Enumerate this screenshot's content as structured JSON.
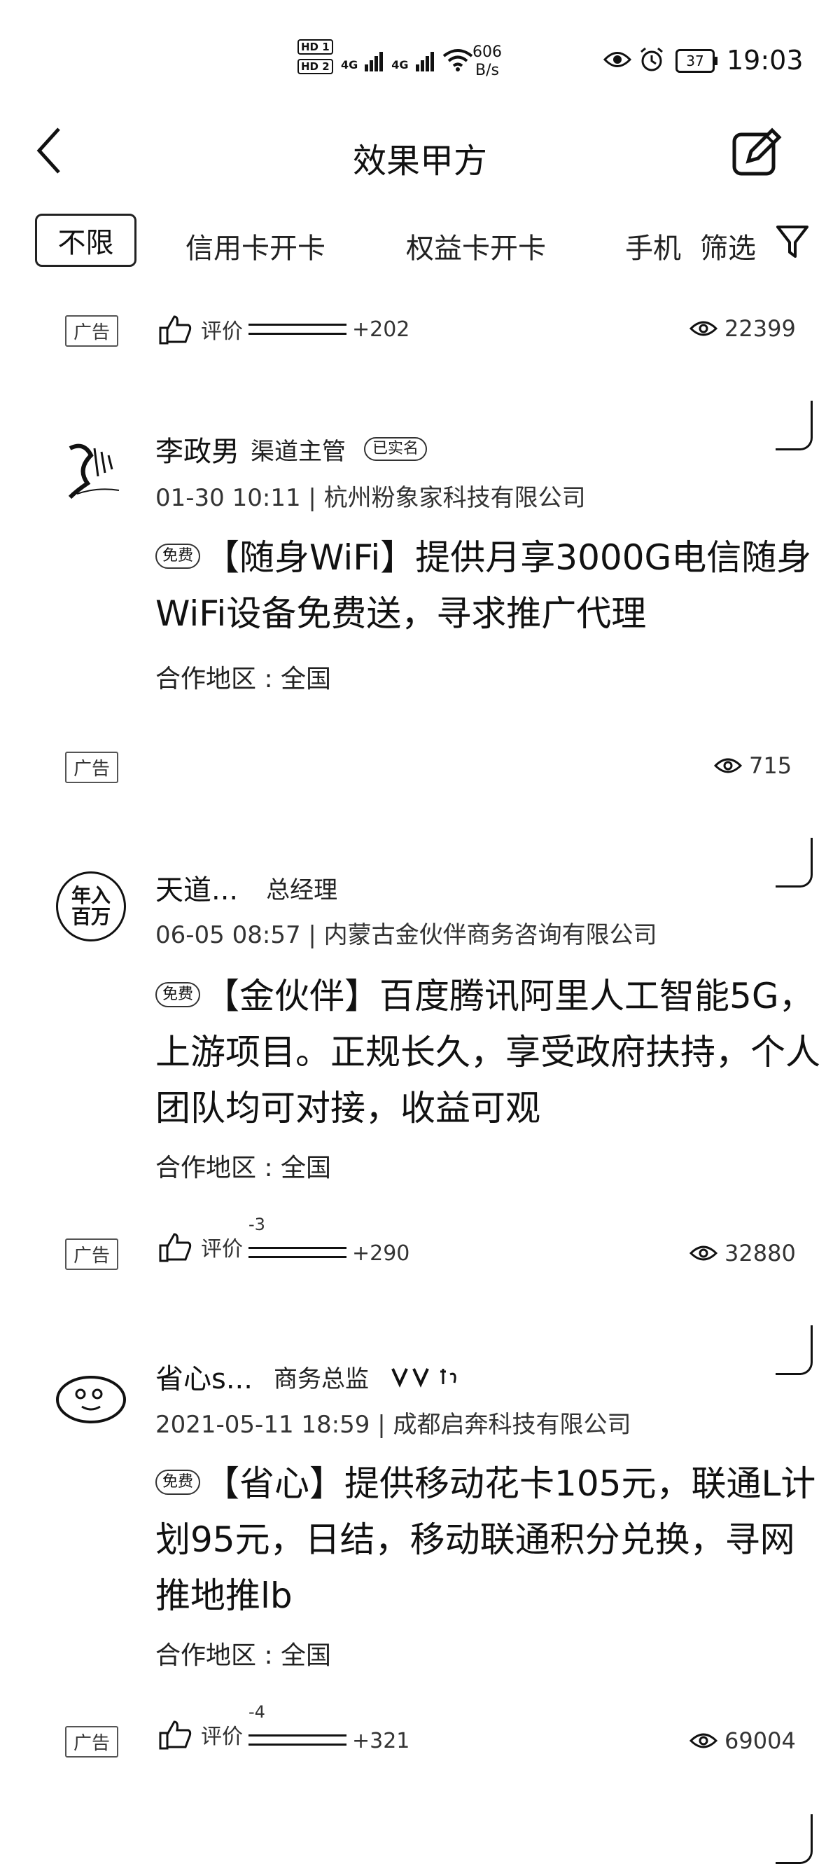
{
  "status_bar": {
    "net_speed_value": "606",
    "net_speed_unit": "B/s",
    "battery": "37",
    "time": "19:03",
    "hd1": "HD 1",
    "hd2": "HD 2",
    "sim1": "4G",
    "sim2": "4G"
  },
  "header": {
    "title": "效果甲方"
  },
  "tabs": [
    {
      "label": "不限"
    },
    {
      "label": "信用卡开卡"
    },
    {
      "label": "权益卡开卡"
    },
    {
      "label": "手机"
    },
    {
      "label": "筛选"
    }
  ],
  "list": [
    {
      "top_ad": "广告",
      "rating_label": "评价",
      "rating_count": "+202",
      "views": "22399"
    },
    {
      "name": "李政男",
      "role": "渠道主管",
      "verified": "已实名",
      "time": "01-30 10:11",
      "company": "杭州粉象家科技有限公司",
      "free": "免费",
      "title": "【随身WiFi】提供月享3000G电信随身WiFi设备免费送，寻求推广代理",
      "region": "合作地区 : 全国",
      "ad": "广告",
      "views": "715"
    },
    {
      "name": "天道...",
      "role": "总经理",
      "avatar_text": "年入百万",
      "time": "06-05 08:57",
      "company": "内蒙古金伙伴商务咨询有限公司",
      "free": "免费",
      "title": "【金伙伴】百度腾讯阿里人工智能5G，上游项目。正规长久，享受政府扶持，个人团队均可对接，收益可观",
      "region": "合作地区 : 全国",
      "ad": "广告",
      "rating_label": "评价",
      "rating_neg": "-3",
      "rating_count": "+290",
      "views": "32880"
    },
    {
      "name": "省心s...",
      "role": "商务总监",
      "time": "2021-05-11 18:59",
      "company": "成都启奔科技有限公司",
      "free": "免费",
      "title": "【省心】提供移动花卡105元，联通L计划95元，日结，移动联通积分兑换，寻网推地推lb",
      "region": "合作地区 : 全国",
      "ad": "广告",
      "rating_label": "评价",
      "rating_neg": "-4",
      "rating_count": "+321",
      "views": "69004"
    }
  ]
}
